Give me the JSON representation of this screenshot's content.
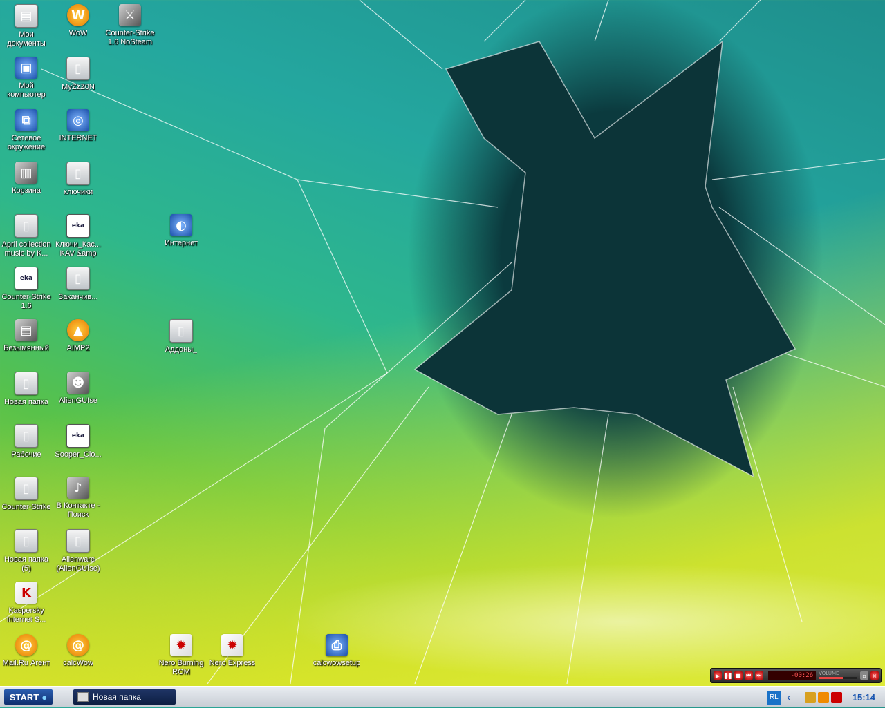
{
  "desktop": {
    "icons": [
      {
        "label": "Мои документы",
        "glyph": "▤",
        "style": "folder"
      },
      {
        "label": "WoW",
        "glyph": "W",
        "style": "orange"
      },
      {
        "label": "Counter-Strike 1.6 NoSteam",
        "glyph": "⚔",
        "style": "dark"
      },
      {
        "label": "Мой компьютер",
        "glyph": "▣",
        "style": "blue"
      },
      {
        "label": "MyZzZ0N",
        "glyph": "▯",
        "style": "folder"
      },
      {
        "label": "Сетевое окружение",
        "glyph": "⧉",
        "style": "blue"
      },
      {
        "label": "INTERNET",
        "glyph": "◎",
        "style": "blue"
      },
      {
        "label": "Корзина",
        "glyph": "▥",
        "style": "dark"
      },
      {
        "label": "ключики",
        "glyph": "▯",
        "style": "folder"
      },
      {
        "label": "April collection music by K...",
        "glyph": "▯",
        "style": "folder"
      },
      {
        "label": "Ключи_Кас... KAV &amp",
        "glyph": "eka",
        "style": "doc"
      },
      {
        "label": "Интернет",
        "glyph": "◐",
        "style": "blue"
      },
      {
        "label": "Counter-Strike 1.6",
        "glyph": "eka",
        "style": "doc"
      },
      {
        "label": "Заканчив...",
        "glyph": "▯",
        "style": "folder"
      },
      {
        "label": "Безымянный",
        "glyph": "▤",
        "style": "dark"
      },
      {
        "label": "AIMP2",
        "glyph": "▲",
        "style": "orange"
      },
      {
        "label": "Аддоны_",
        "glyph": "▯",
        "style": "folder"
      },
      {
        "label": "Новая папка",
        "glyph": "▯",
        "style": "folder"
      },
      {
        "label": "AlienGUIse",
        "glyph": "☻",
        "style": "dark"
      },
      {
        "label": "Рабочие",
        "glyph": "▯",
        "style": "folder"
      },
      {
        "label": "Sooper_Clo...",
        "glyph": "eka",
        "style": "doc"
      },
      {
        "label": "Counter-Strike",
        "glyph": "▯",
        "style": "folder"
      },
      {
        "label": "В Контакте - Поиск",
        "glyph": "♪",
        "style": "dark"
      },
      {
        "label": "Новая папка (5)",
        "glyph": "▯",
        "style": "folder"
      },
      {
        "label": "Alienware (AlienGUIse)",
        "glyph": "▯",
        "style": "folder"
      },
      {
        "label": "Kaspersky Internet S...",
        "glyph": "K",
        "style": "red"
      },
      {
        "label": "Mail.Ru Агент",
        "glyph": "@",
        "style": "orange"
      },
      {
        "label": "calcWow",
        "glyph": "@",
        "style": "orange"
      },
      {
        "label": "Nero Burning ROM",
        "glyph": "✹",
        "style": "red"
      },
      {
        "label": "Nero Express",
        "glyph": "✹",
        "style": "red"
      },
      {
        "label": "calcwowsetup",
        "glyph": "⎙",
        "style": "blue"
      }
    ]
  },
  "player": {
    "time": "-00:26",
    "volume_label": "VOLUME",
    "volume_level": 0.62,
    "buttons": [
      "play",
      "pause",
      "stop",
      "prev",
      "next"
    ]
  },
  "taskbar": {
    "start_label": "START",
    "task_label": "Новая папка",
    "lang": "RL",
    "clock": "15:14"
  }
}
